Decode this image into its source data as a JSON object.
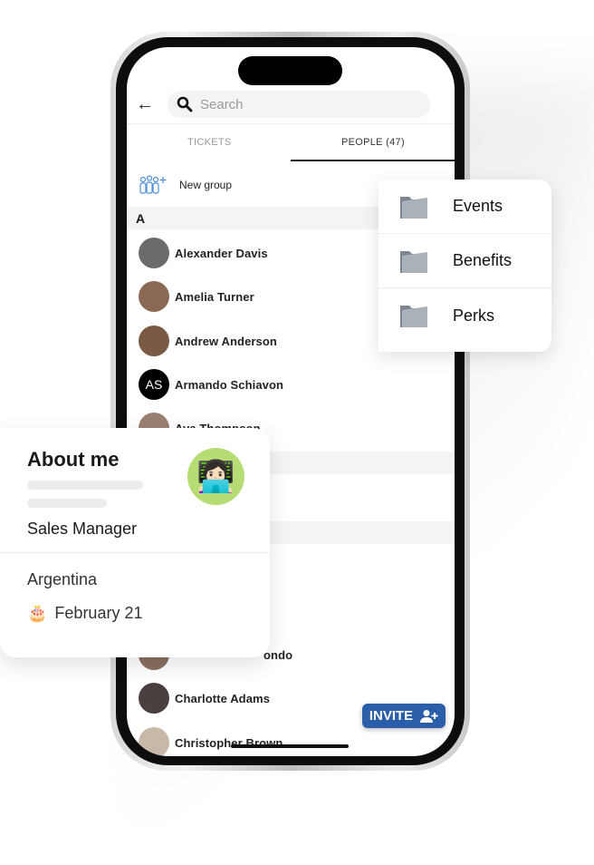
{
  "search": {
    "placeholder": "Search",
    "icon": "search-icon"
  },
  "tabs": [
    {
      "label": "TICKETS",
      "active": false
    },
    {
      "label": "PEOPLE (47)",
      "active": true
    }
  ],
  "new_group": {
    "label": "New group",
    "icon": "group-add-icon"
  },
  "sections": [
    {
      "letter": "A"
    }
  ],
  "people": [
    {
      "name": "Alexander Davis",
      "avatar_color": "#6b6b6b"
    },
    {
      "name": "Amelia Turner",
      "avatar_color": "#8a6a55"
    },
    {
      "name": "Andrew Anderson",
      "avatar_color": "#7a5a45"
    },
    {
      "name": "Armando Schiavon",
      "initials": "AS",
      "avatar_color": "#000000"
    },
    {
      "name": "Ava Thompson",
      "avatar_color": "#9a8070"
    },
    {
      "name": "ondo",
      "avatar_color": "#8a7060"
    },
    {
      "name": "Charlotte Adams",
      "avatar_color": "#4a4040"
    },
    {
      "name": "Christopher Brown",
      "avatar_color": "#c8b8a8"
    }
  ],
  "invite": {
    "label": "INVITE",
    "icon": "person-add-icon",
    "color": "#2a5ea8"
  },
  "folders": [
    {
      "label": "Events"
    },
    {
      "label": "Benefits"
    },
    {
      "label": "Perks"
    }
  ],
  "about": {
    "title": "About me",
    "role": "Sales Manager",
    "country": "Argentina",
    "birthday": "February 21",
    "birthday_icon": "cake-icon",
    "avatar_emoji": "👩🏻‍💻",
    "avatar_bg": "#b6dc74"
  }
}
